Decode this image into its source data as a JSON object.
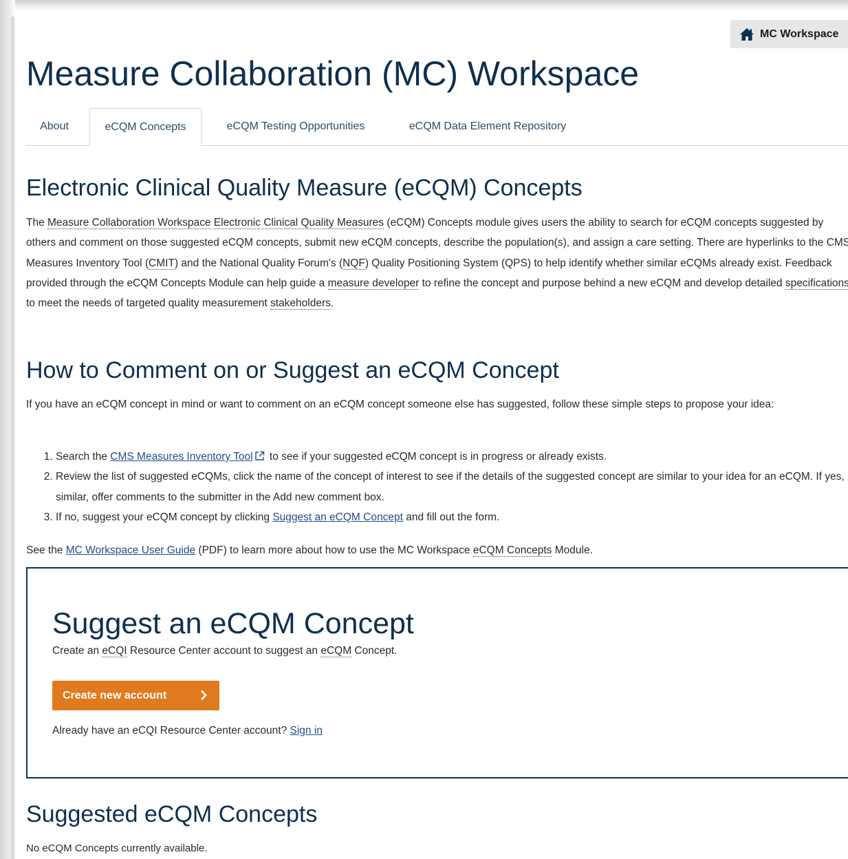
{
  "badge": {
    "label": "MC Workspace",
    "icon": "home-icon"
  },
  "page_title": "Measure Collaboration (MC) Workspace",
  "tabs": [
    {
      "label": "About",
      "active": false
    },
    {
      "label": "eCQM Concepts",
      "active": true
    },
    {
      "label": "eCQM Testing Opportunities",
      "active": false
    },
    {
      "label": "eCQM Data Element Repository",
      "active": false
    }
  ],
  "concepts_section": {
    "heading": "Electronic Clinical Quality Measure (eCQM) Concepts",
    "p1_a": "The ",
    "p1_mcw": "Measure Collaboration Workspace",
    "p1_sp1": " ",
    "p1_ecqm": "Electronic Clinical Quality Measures",
    "p1_b": " (eCQM) Concepts module gives users the ability to search for eCQM concepts suggested by others and comment on those suggested eCQM concepts, submit new eCQM concepts, describe the population(s), and assign a care setting. There are hyperlinks to the CMS Measures Inventory Tool (",
    "p1_cmit": "CMIT",
    "p1_c": ") and the National Quality Forum's (",
    "p1_nqf": "NQF",
    "p1_d": ") Quality Positioning System (QPS) to help identify whether similar eCQMs already exist. Feedback provided through the eCQM Concepts Module can help guide a ",
    "p1_dev": "measure developer",
    "p1_e": " to refine the concept and purpose behind a new eCQM and develop detailed ",
    "p1_spec": "specifications",
    "p1_f": " to meet the needs of targeted quality measurement ",
    "p1_stake": "stakeholders",
    "p1_g": "."
  },
  "howto_section": {
    "heading": "How to Comment on or Suggest an eCQM Concept",
    "intro": "If you have an eCQM concept in mind or want to comment on an eCQM concept someone else has suggested, follow these simple steps to propose your idea:",
    "step1_a": "Search the ",
    "step1_link": "CMS Measures Inventory Tool",
    "step1_b": " to see if your suggested eCQM concept is in progress or already exists.",
    "step2": "Review the list of suggested eCQMs, click the name of the concept of interest to see if the details of the suggested concept are similar to your idea for an eCQM. If yes, it is similar, offer comments to the submitter in the Add new comment box.",
    "step3_a": "If no, suggest your eCQM concept by clicking ",
    "step3_link": "Suggest an eCQM Concept",
    "step3_b": " and fill out the form.",
    "guide_a": "See the ",
    "guide_link": "MC Workspace User Guide",
    "guide_b": " (PDF) to learn more about how to use the MC Workspace ",
    "guide_dotted": "eCQM Concepts",
    "guide_c": " Module."
  },
  "suggest_box": {
    "title": "Suggest an eCQM Concept",
    "sub_a": "Create an ",
    "sub_ecqi": "eCQI",
    "sub_b": " Resource Center account to suggest an ",
    "sub_ecqm": "eCQM",
    "sub_c": " Concept.",
    "button_label": "Create new account",
    "signin_prefix": "Already have an eCQI Resource Center account?",
    "signin_link": "Sign in"
  },
  "suggested_section": {
    "heading": "Suggested eCQM Concepts",
    "empty_message": "No eCQM Concepts currently available."
  },
  "colors": {
    "heading": "#0f2f4f",
    "accent_button": "#e07a1f",
    "link": "#1f4e8c"
  }
}
